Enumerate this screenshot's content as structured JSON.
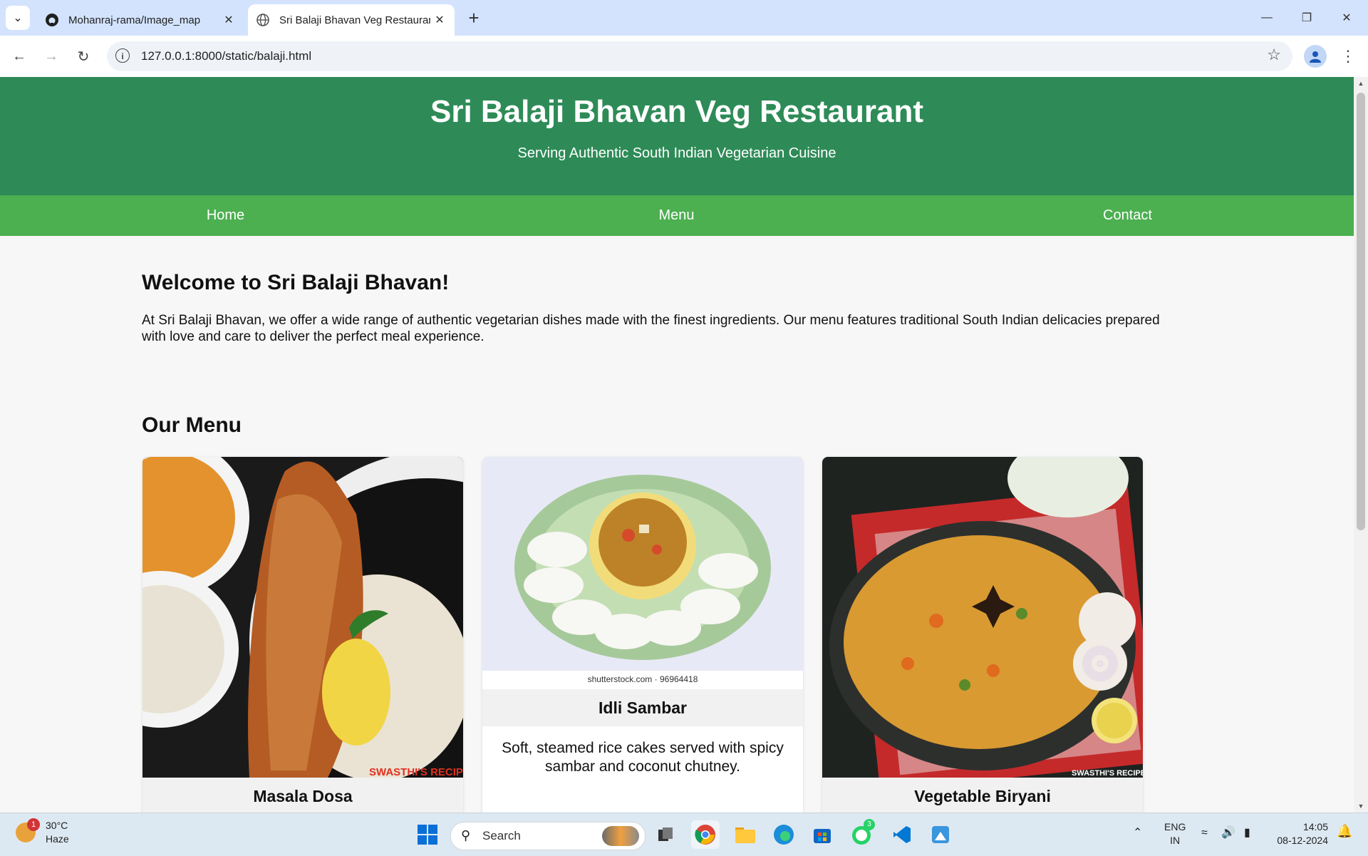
{
  "browser": {
    "tabs": [
      {
        "title": "Mohanraj-rama/Image_map",
        "active": false
      },
      {
        "title": "Sri Balaji Bhavan Veg Restaurant",
        "active": true
      }
    ],
    "url": "127.0.0.1:8000/static/balaji.html"
  },
  "site": {
    "title": "Sri Balaji Bhavan Veg Restaurant",
    "tagline": "Serving Authentic South Indian Vegetarian Cuisine",
    "nav": [
      "Home",
      "Menu",
      "Contact"
    ],
    "welcome_heading": "Welcome to Sri Balaji Bhavan!",
    "welcome_text": "At Sri Balaji Bhavan, we offer a wide range of authentic vegetarian dishes made with the finest ingredients. Our menu features traditional South Indian delicacies prepared with love and care to deliver the perfect meal experience.",
    "menu_heading": "Our Menu",
    "menu_items": [
      {
        "name": "Masala Dosa",
        "image_caption": "SWASTHI'S RECIPES"
      },
      {
        "name": "Idli Sambar",
        "description": "Soft, steamed rice cakes served with spicy sambar and coconut chutney.",
        "image_caption": "shutterstock.com · 96964418"
      },
      {
        "name": "Vegetable Biryani",
        "image_caption": "SWASTHI'S RECIPES"
      }
    ]
  },
  "taskbar": {
    "weather_temp": "30°C",
    "weather_desc": "Haze",
    "weather_badge": "1",
    "search_label": "Search",
    "whatsapp_badge": "3",
    "lang_line1": "ENG",
    "lang_line2": "IN",
    "time": "14:05",
    "date": "08-12-2024"
  },
  "colors": {
    "header": "#2e8b57",
    "nav": "#4caf50",
    "page_bg": "#f7f7f7"
  }
}
